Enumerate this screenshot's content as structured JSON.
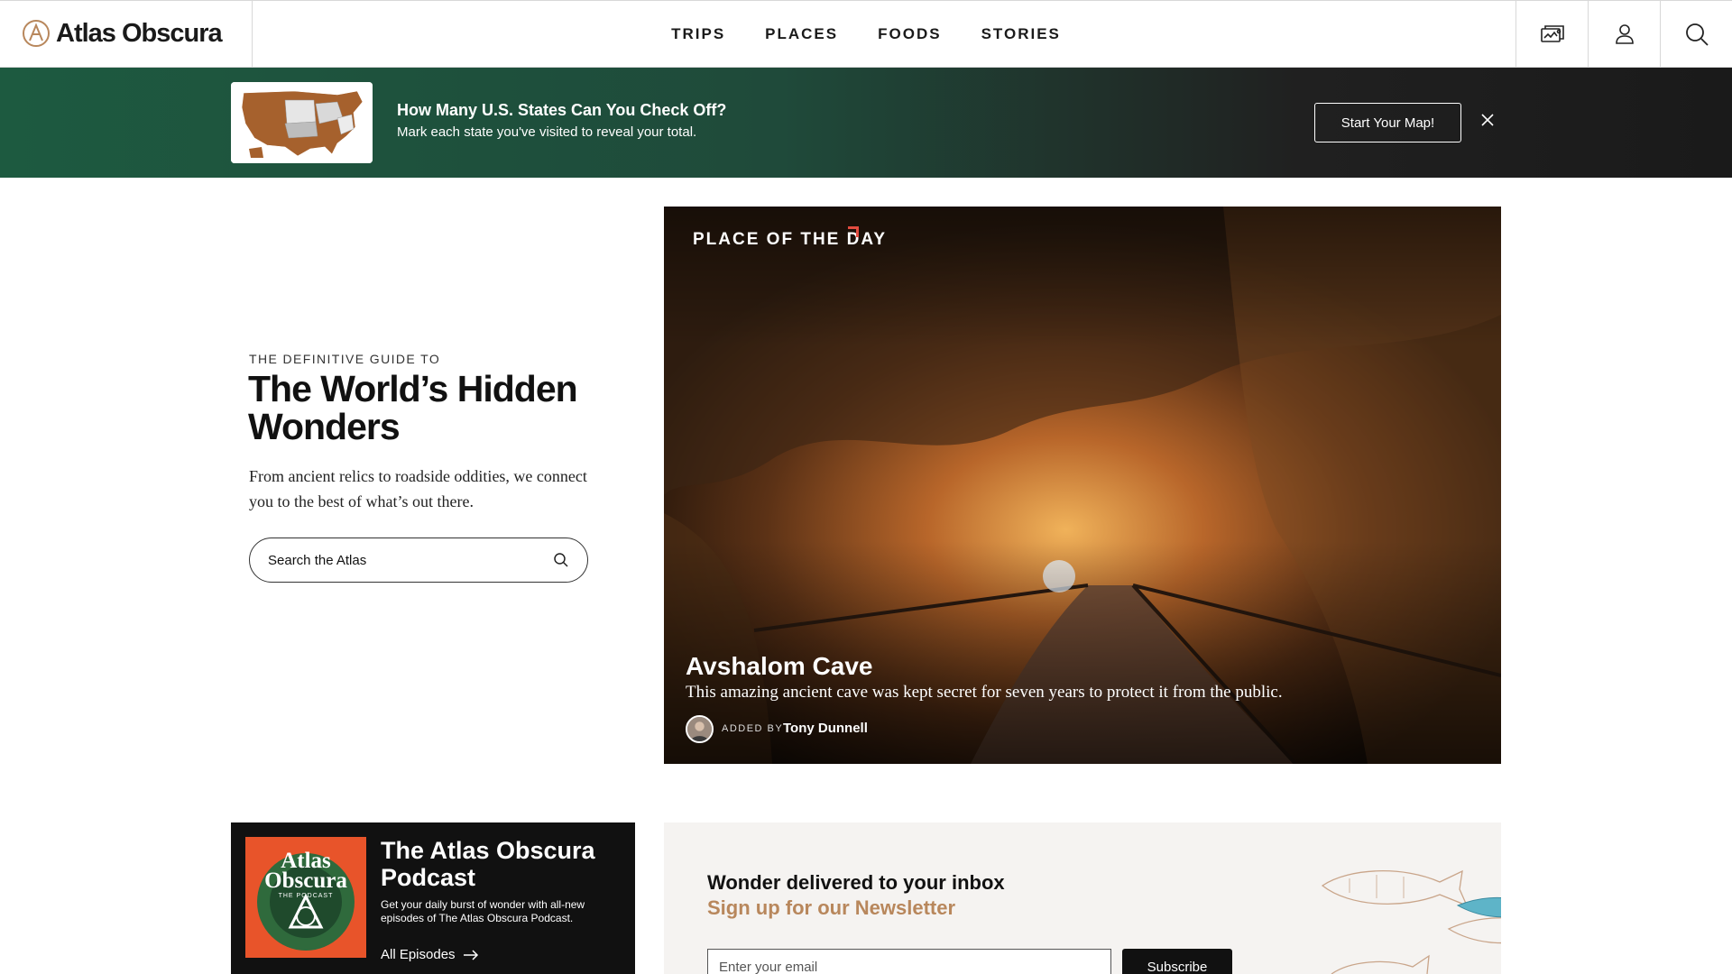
{
  "header": {
    "logo_text": "Atlas Obscura",
    "nav": [
      "TRIPS",
      "PLACES",
      "FOODS",
      "STORIES"
    ],
    "icons": [
      "map-card-icon",
      "user-icon",
      "search-icon"
    ]
  },
  "banner": {
    "title": "How Many U.S. States Can You Check Off?",
    "subtitle": "Mark each state you've visited to reveal your total.",
    "button": "Start Your Map!",
    "close_icon": "close-icon"
  },
  "hero": {
    "eyebrow": "THE DEFINITIVE GUIDE TO",
    "title": "The World’s Hidden Wonders",
    "description": "From ancient relics to roadside oddities, we connect you to the best of what’s out there.",
    "search_placeholder": "Search the Atlas"
  },
  "place_of_day": {
    "label": "PLACE OF THE DAY",
    "name": "Avshalom Cave",
    "description": "This amazing ancient cave was kept secret for seven years to protect it from the public.",
    "added_by_label": "ADDED BY",
    "author": "Tony Dunnell"
  },
  "podcast": {
    "cover_title": "Atlas Obscura",
    "cover_sub": "THE PODCAST",
    "title": "The Atlas Obscura Podcast",
    "description": "Get your daily burst of wonder with all-new episodes of The Atlas Obscura Podcast.",
    "link": "All Episodes"
  },
  "newsletter": {
    "title": "Wonder delivered to your inbox",
    "subtitle": "Sign up for our Newsletter",
    "email_placeholder": "Enter your email",
    "button": "Subscribe"
  },
  "colors": {
    "accent_red": "#e34b3f",
    "newsletter_gold": "#b8875c",
    "banner_green": "#1d5a40"
  }
}
